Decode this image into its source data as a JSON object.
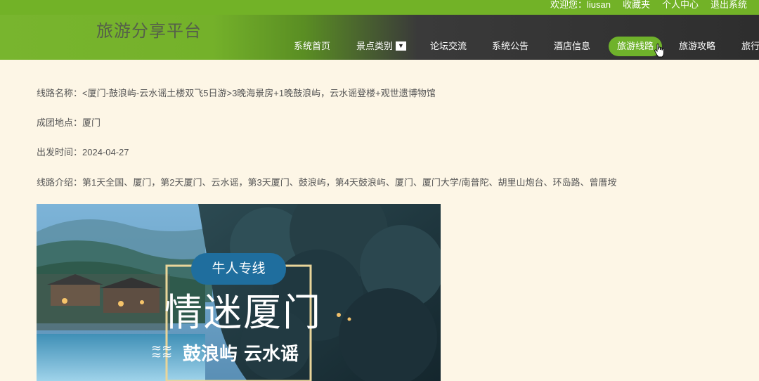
{
  "header": {
    "logo": "旅游分享平台",
    "user_links": {
      "welcome": "欢迎您：liusan",
      "favorites": "收藏夹",
      "profile": "个人中心",
      "logout": "退出系统"
    },
    "nav": [
      {
        "label": "系统首页"
      },
      {
        "label": "景点类别"
      },
      {
        "label": "论坛交流"
      },
      {
        "label": "系统公告"
      },
      {
        "label": "酒店信息"
      },
      {
        "label": "旅游线路"
      },
      {
        "label": "旅游攻略"
      },
      {
        "label": "旅行"
      }
    ],
    "active_nav": "旅游线路",
    "caret_glyph": "▼"
  },
  "detail": {
    "route_name": "线路名称：<厦门-鼓浪屿-云水谣土楼双飞5日游>3晚海景房+1晚鼓浪屿，云水谣登楼+观世遗博物馆",
    "group_location": "成团地点：厦门",
    "departure_time": "出发时间：2024-04-27",
    "route_intro": "线路介绍：第1天全国、厦门，第2天厦门、云水谣，第3天厦门、鼓浪屿，第4天鼓浪屿、厦门、厦门大学/南普陀、胡里山炮台、环岛路、曾厝垵"
  },
  "photo": {
    "badge": "牛人专线",
    "title": "情迷厦门",
    "subtitle": "鼓浪屿 云水谣"
  },
  "colors": {
    "brand_green": "#72b227",
    "page_bg": "#fdf6e6",
    "nav_dark": "#2e2e2e",
    "text_gray": "#555555"
  }
}
